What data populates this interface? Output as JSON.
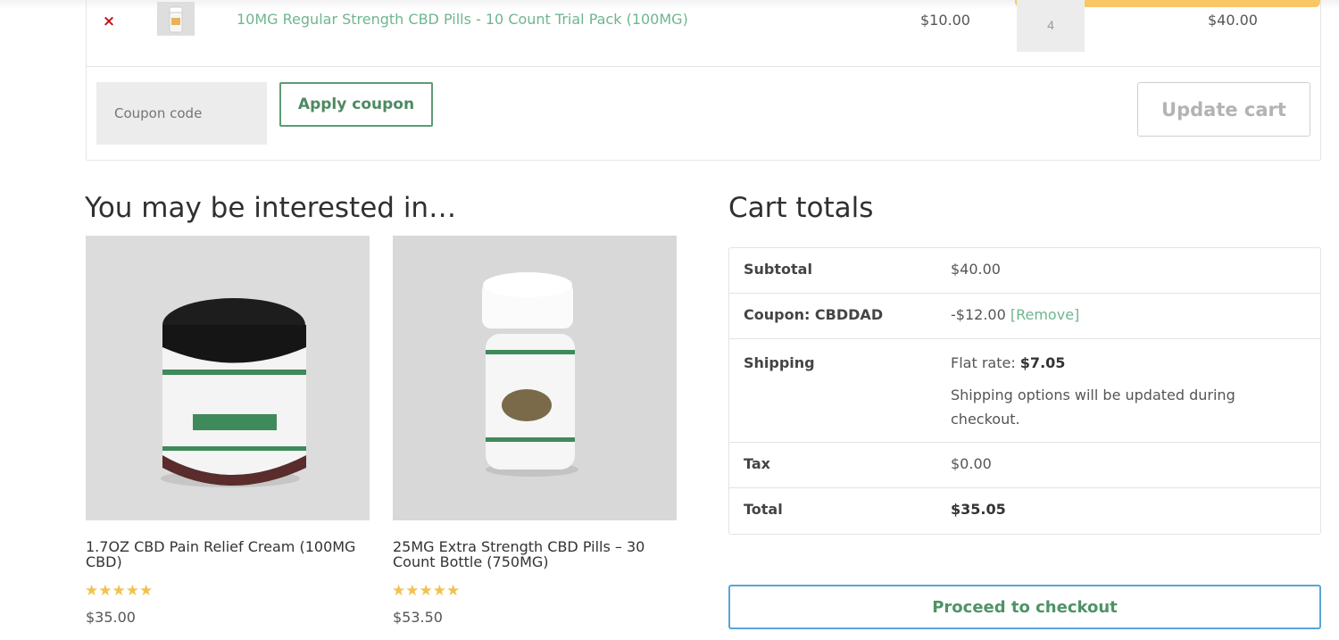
{
  "cart": {
    "remove_symbol": "×",
    "item": {
      "name": "10MG Regular Strength CBD Pills - 10 Count Trial Pack (100MG)",
      "price": "$10.00",
      "quantity": "4",
      "subtotal": "$40.00"
    },
    "coupon_placeholder": "Coupon code",
    "apply_coupon_label": "Apply coupon",
    "update_cart_label": "Update cart"
  },
  "related": {
    "heading": "You may be interested in…",
    "products": [
      {
        "title": "1.7OZ CBD Pain Relief Cream (100MG CBD)",
        "rating": "★★★★★",
        "rating_value": 5,
        "price": "$35.00"
      },
      {
        "title": "25MG Extra Strength CBD Pills – 30 Count Bottle (750MG)",
        "rating": "★★★★★",
        "rating_value": 5,
        "price": "$53.50"
      }
    ]
  },
  "totals": {
    "heading": "Cart totals",
    "subtotal_label": "Subtotal",
    "subtotal_value": "$40.00",
    "coupon_label": "Coupon: CBDDAD",
    "coupon_value": "-$12.00",
    "coupon_remove": "[Remove]",
    "shipping_label": "Shipping",
    "shipping_method": "Flat rate: ",
    "shipping_price": "$7.05",
    "shipping_note": "Shipping options will be updated during checkout.",
    "tax_label": "Tax",
    "tax_value": "$0.00",
    "total_label": "Total",
    "total_value": "$35.05"
  },
  "checkout_label": "Proceed to checkout",
  "colors": {
    "link_green": "#6fb68f",
    "button_green": "#4d8a62",
    "remove_red": "#c0171d",
    "checkout_border": "#56a6d9",
    "star_gold": "#f2c14e"
  }
}
